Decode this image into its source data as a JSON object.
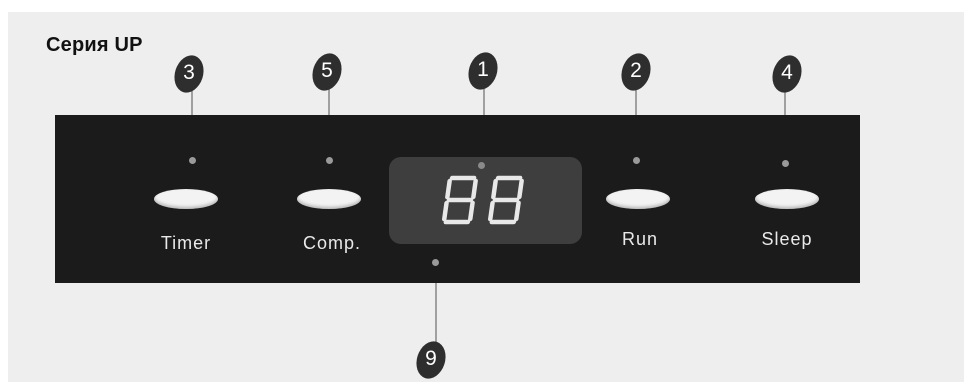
{
  "title": "Серия UP",
  "display": {
    "readout": "88"
  },
  "buttons": [
    {
      "label": "Timer",
      "callout": "3"
    },
    {
      "label": "Comp.",
      "callout": "5"
    },
    {
      "label": "Run",
      "callout": "2"
    },
    {
      "label": "Sleep",
      "callout": "4"
    }
  ],
  "callouts": {
    "display": "1",
    "display_bottom": "9"
  },
  "colors": {
    "panel": "#1b1b1b",
    "display_window": "#3e3e3e",
    "button": "#f3f3f3",
    "callout_badge": "#2e2e2e",
    "leader_dot": "#9a9a9a"
  }
}
